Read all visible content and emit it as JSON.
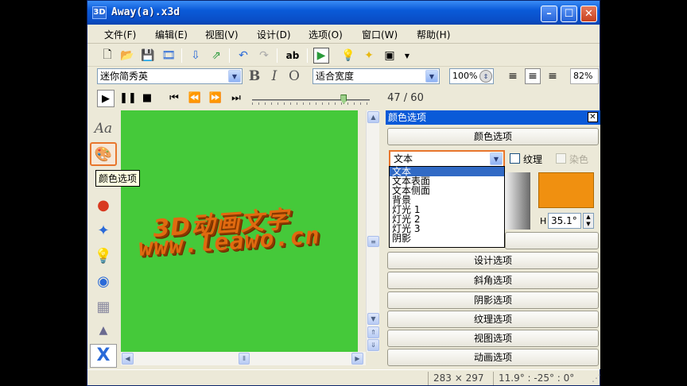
{
  "window": {
    "app_icon": "3D",
    "title": "Away(a).x3d",
    "minimize": "–",
    "maximize": "☐",
    "close": "✕"
  },
  "menu": [
    "文件(F)",
    "编辑(E)",
    "视图(V)",
    "设计(D)",
    "选项(O)",
    "窗口(W)",
    "帮助(H)"
  ],
  "toolbar": {
    "font_name": "迷你简秀英",
    "bold": "B",
    "italic": "I",
    "outline": "O",
    "fit_mode": "适合宽度",
    "zoom": "100%",
    "percent": "82%",
    "text_button": "ab"
  },
  "playback": {
    "frame": "47 / 60",
    "slider_fraction": 0.78
  },
  "left_tools": {
    "text_tool": "Aa",
    "tooltip": "颜色选项"
  },
  "canvas": {
    "line1": "3D动画文字",
    "line2": "www.leawo.cn",
    "bg": "#45c93a"
  },
  "panel": {
    "title": "颜色选项",
    "header_bar": "颜色选项",
    "target": "文本",
    "texture_label": "纹理",
    "dye_label": "染色",
    "hue_label": "H",
    "hue_value": "35.1°",
    "swatch_color": "#f09010",
    "dropdown": [
      "文本",
      "文本表面",
      "文本侧面",
      "背景",
      "灯光 1",
      "灯光 2",
      "灯光 3",
      "阴影"
    ],
    "sections": [
      "设计选项",
      "斜角选项",
      "阴影选项",
      "纹理选项",
      "视图选项",
      "动画选项"
    ]
  },
  "status": {
    "size": "283 × 297",
    "angles": "11.9° : -25° : 0°"
  }
}
